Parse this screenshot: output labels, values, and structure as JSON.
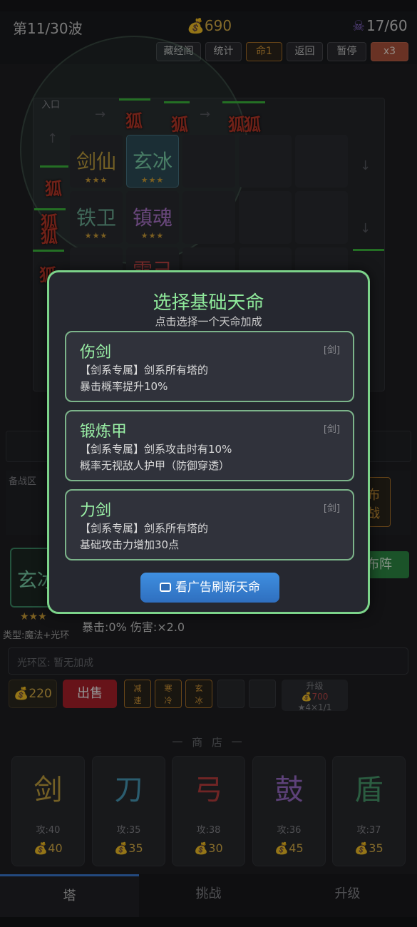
{
  "hud": {
    "wave": "第11/30波",
    "gold": "690",
    "lives": "17/60"
  },
  "toolbar": {
    "library": "藏经阁",
    "stats": "统计",
    "fate": "命1",
    "back": "返回",
    "pause": "暂停",
    "speed": "x3"
  },
  "map": {
    "entry": "入口",
    "towers": [
      {
        "name": "剑仙",
        "stars": "★★★",
        "color": "#c9a640"
      },
      {
        "name": "玄冰",
        "stars": "★★★",
        "color": "#7fd9b0"
      },
      {
        "name": "铁卫",
        "stars": "★★★",
        "color": "#6fb39a"
      },
      {
        "name": "镇魂",
        "stars": "★★★",
        "color": "#b57ad6"
      },
      {
        "name": "雷己",
        "stars": "",
        "color": "#d04a4a"
      }
    ],
    "enemy_label": "狐"
  },
  "detail": {
    "selected_tower": "玄冰",
    "stars": "★★★",
    "type": "类型:魔法+光环",
    "crit": "暴击:0%  伤害:×2.0",
    "aura": "光环区: 暂无加成",
    "deploy": "布阵",
    "fabu_top": "布",
    "fabu_bottom": "战",
    "prep": "备战区"
  },
  "actions": {
    "sell_value": "220",
    "sell": "出售",
    "chips": [
      {
        "top": "减",
        "bottom": "速"
      },
      {
        "top": "寒",
        "bottom": "冷"
      },
      {
        "top": "玄",
        "bottom": "冰"
      }
    ],
    "upgrade": {
      "label": "升级",
      "cost": "700",
      "req": "★4×1/1"
    }
  },
  "shop": {
    "title": "一 商 店 一",
    "items": [
      {
        "glyph": "剑",
        "atk": "攻:40",
        "price": "40",
        "color": "#c9a640"
      },
      {
        "glyph": "刀",
        "atk": "攻:35",
        "price": "35",
        "color": "#4aa0c0"
      },
      {
        "glyph": "弓",
        "atk": "攻:38",
        "price": "30",
        "color": "#c04040"
      },
      {
        "glyph": "鼓",
        "atk": "攻:36",
        "price": "45",
        "color": "#a070d0"
      },
      {
        "glyph": "盾",
        "atk": "攻:37",
        "price": "35",
        "color": "#4aa070"
      }
    ]
  },
  "nav": {
    "tower": "塔",
    "challenge": "挑战",
    "upgrade": "升级"
  },
  "modal": {
    "title": "选择基础天命",
    "subtitle": "点击选择一个天命加成",
    "cards": [
      {
        "name": "伤剑",
        "tag": "[剑]",
        "line1": "【剑系专属】剑系所有塔的",
        "line2": "暴击概率提升10%"
      },
      {
        "name": "锻炼甲",
        "tag": "[剑]",
        "line1": "【剑系专属】剑系攻击时有10%",
        "line2": "概率无视敌人护甲（防御穿透）"
      },
      {
        "name": "力剑",
        "tag": "[剑]",
        "line1": "【剑系专属】剑系所有塔的",
        "line2": "基础攻击力增加30点"
      }
    ],
    "ad_button": "看广告刷新天命"
  },
  "colors": {
    "accent_green": "#7cd38a",
    "gold": "#e5b84b",
    "ad_blue": "#3f8fe0"
  }
}
